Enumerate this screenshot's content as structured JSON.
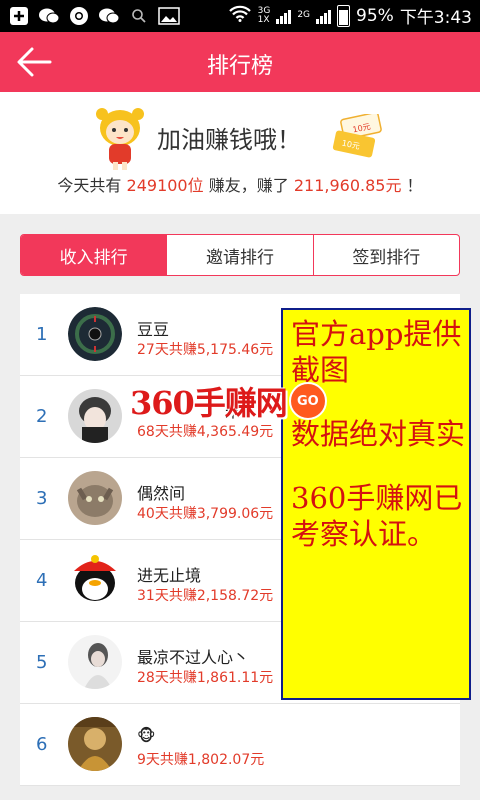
{
  "status_bar": {
    "left_icons": [
      "plus-icon",
      "wechat-icon",
      "chrome-icon",
      "wechat-icon",
      "search-icon",
      "image-icon"
    ],
    "network_top": "3G",
    "network_bottom": "1X",
    "network2": "2G",
    "battery": "95%",
    "time": "下午3:43"
  },
  "header": {
    "title": "排行榜",
    "back_icon": "arrow-left-icon"
  },
  "banner": {
    "cheer": "加油赚钱哦！",
    "coin_top": "10元",
    "coin_bottom": "10元",
    "summary_prefix": "今天共有",
    "user_count": "249100位",
    "summary_middle": "赚友，赚了",
    "total_amount": "211,960.85元",
    "summary_suffix": "！"
  },
  "tabs": [
    {
      "label": "收入排行",
      "active": true
    },
    {
      "label": "邀请排行",
      "active": false
    },
    {
      "label": "签到排行",
      "active": false
    }
  ],
  "ranking": [
    {
      "rank": "1",
      "name": "豆豆",
      "earned": "27天共赚5,175.46元"
    },
    {
      "rank": "2",
      "name": "米",
      "earned": "68天共赚4,365.49元"
    },
    {
      "rank": "3",
      "name": "偶然间",
      "earned": "40天共赚3,799.06元"
    },
    {
      "rank": "4",
      "name": "进无止境",
      "earned": "31天共赚2,158.72元"
    },
    {
      "rank": "5",
      "name": "最凉不过人心丶",
      "earned": "28天共赚1,861.11元"
    },
    {
      "rank": "6",
      "name": "🐵",
      "earned": "9天共赚1,802.07元"
    }
  ],
  "notice": {
    "line1": "官方app提供截图",
    "line2": "数据绝对真实",
    "line3": "360手赚网已考察认证。"
  },
  "watermark": {
    "text": "360手赚网",
    "badge": "GO"
  },
  "colors": {
    "brand": "#f2385a",
    "money": "#e23b2a",
    "rank": "#2d6fb6",
    "notice_bg": "#ffff00",
    "notice_text": "#d41111"
  }
}
